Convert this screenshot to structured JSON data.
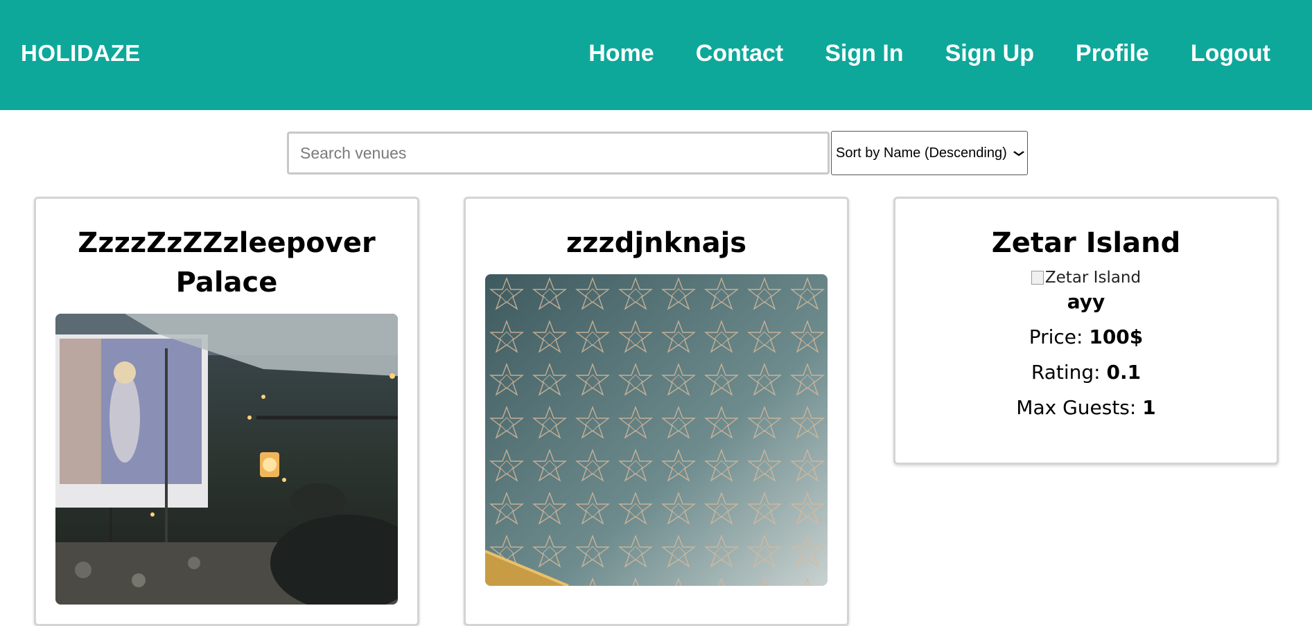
{
  "navbar": {
    "brand": "HOLIDAZE",
    "links": [
      "Home",
      "Contact",
      "Sign In",
      "Sign Up",
      "Profile",
      "Logout"
    ],
    "background": "#0ea89a"
  },
  "search": {
    "placeholder": "Search venues",
    "value": ""
  },
  "sort": {
    "selected": "Sort by Name (Descending)"
  },
  "venues": [
    {
      "name": "ZzzzZzZZzleepover Palace",
      "image": "campsite-movie-night-photo"
    },
    {
      "name": "zzzdjnknajs",
      "image": "geometric-star-wallpaper-photo"
    },
    {
      "name": "Zetar Island",
      "image_alt": "Zetar Island",
      "description": "ayy",
      "price_label": "Price: ",
      "price": "100$",
      "rating_label": "Rating: ",
      "rating": "0.1",
      "guests_label": "Max Guests: ",
      "guests": "1"
    }
  ]
}
